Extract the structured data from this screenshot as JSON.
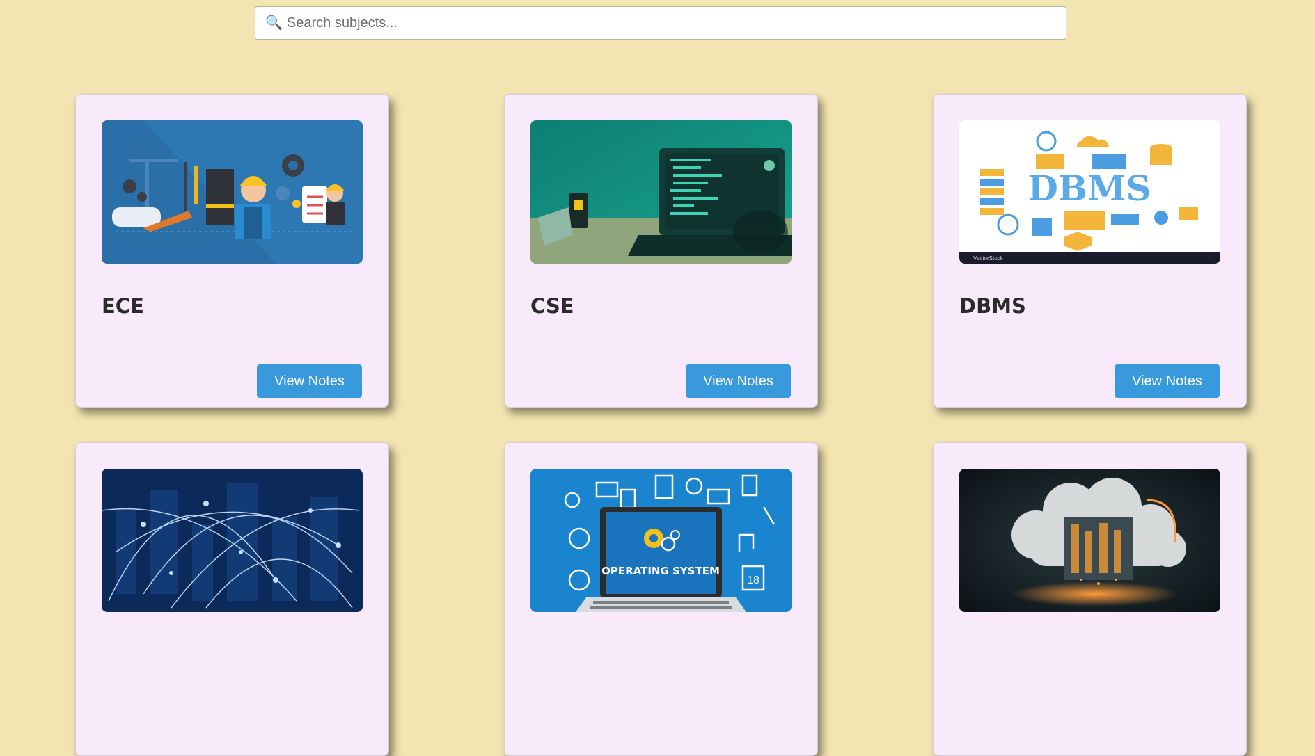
{
  "search": {
    "placeholder": "Search subjects...",
    "icon": "magnifier-icon"
  },
  "accent_color": "#3899dc",
  "background_color": "#f3e5b1",
  "subjects": [
    {
      "title": "ECE",
      "button_label": "View Notes",
      "image": "engineering-workers-illustration"
    },
    {
      "title": "CSE",
      "button_label": "View Notes",
      "image": "laptop-code-illustration"
    },
    {
      "title": "DBMS",
      "button_label": "View Notes",
      "image": "dbms-infographic",
      "image_text": "DBMS",
      "watermark": "VectorStock"
    },
    {
      "title": "",
      "button_label": "",
      "image": "network-city-photo"
    },
    {
      "title": "",
      "button_label": "",
      "image": "operating-system-laptop-illustration",
      "image_text": "OPERATING SYSTEM",
      "calendar_number": "18"
    },
    {
      "title": "",
      "button_label": "",
      "image": "cloud-computing-illustration"
    }
  ]
}
